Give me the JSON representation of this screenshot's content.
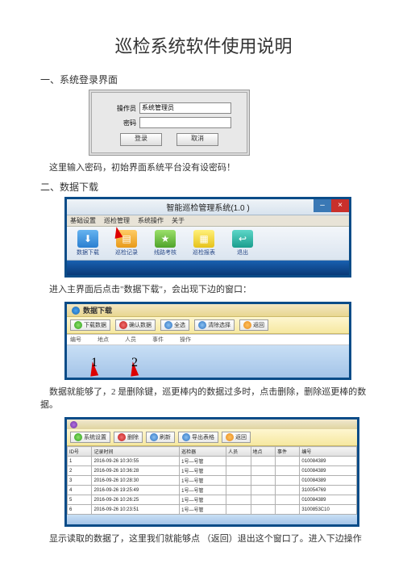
{
  "doc": {
    "title": "巡检系统软件使用说明",
    "section1": "一、系统登录界面",
    "login_note": "这里输入密码，初始界面系统平台没有设密码！",
    "section2": "二、数据下载",
    "main_note": "进入主界面后点击\"数据下载\"，会出现下边的窗口：",
    "dl_note1": "数据就能够了，2 是删除键，巡更棒内的数据过多时，点击删除，删除巡更棒的数据。",
    "table_note": "显示读取的数据了，这里我们就能够点 （返回）退出这个窗口了。进入下边操作"
  },
  "login": {
    "label_user": "操作员",
    "user_value": "系统管理员",
    "label_pass": "密码",
    "btn_login": "登录",
    "btn_cancel": "取消"
  },
  "mainwin": {
    "title": "智能巡检管理系统(1.0 )",
    "menu": {
      "m1": "基础设置",
      "m2": "巡检管理",
      "m3": "系统操作",
      "m4": "关于"
    },
    "tools": {
      "t1": "数据下载",
      "t2": "巡检记录",
      "t3": "线路考核",
      "t4": "巡检报表",
      "t5": "退出"
    }
  },
  "dl": {
    "title": "数据下载",
    "b1": "下载数据",
    "b2": "确认数据",
    "b3": "全选",
    "b4": "清除选择",
    "b5": "返回",
    "f1": "编号",
    "f2": "地点",
    "f3": "人员",
    "f4": "事件",
    "f5": "操作",
    "num1": "1",
    "num2": "2"
  },
  "table": {
    "b1": "系统设置",
    "b2": "删除",
    "b3": "刷新",
    "b4": "导出表格",
    "b5": "返回",
    "headers": {
      "h0": "ID号",
      "h1": "记录时间",
      "h2": "巡检器",
      "h3": "人员",
      "h4": "地点",
      "h5": "事件",
      "h6": "编号"
    },
    "rows": [
      {
        "id": "1",
        "time": "2016-09-26 10:30:55",
        "dev": "1号—号管",
        "person": "",
        "place": "",
        "event": "",
        "code": "010084389"
      },
      {
        "id": "2",
        "time": "2016-09-26 10:36:28",
        "dev": "1号—号管",
        "person": "",
        "place": "",
        "event": "",
        "code": "010084389"
      },
      {
        "id": "3",
        "time": "2016-09-26 10:28:30",
        "dev": "1号—号管",
        "person": "",
        "place": "",
        "event": "",
        "code": "010084389"
      },
      {
        "id": "4",
        "time": "2016-09-26 19:25:49",
        "dev": "1号—号管",
        "person": "",
        "place": "",
        "event": "",
        "code": "310054769"
      },
      {
        "id": "5",
        "time": "2016-09-26 10:26:25",
        "dev": "1号—号管",
        "person": "",
        "place": "",
        "event": "",
        "code": "010084389"
      },
      {
        "id": "6",
        "time": "2016-09-26 10:23:51",
        "dev": "1号—号管",
        "person": "",
        "place": "",
        "event": "",
        "code": "3100853C10"
      }
    ]
  }
}
